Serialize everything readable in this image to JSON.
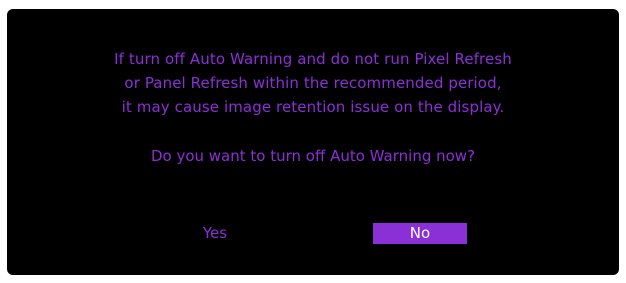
{
  "dialog": {
    "message_lines": [
      "If turn off Auto Warning and do not run Pixel Refresh",
      "or Panel Refresh within the recommended period,",
      "it may cause image retention issue on the display."
    ],
    "question": "Do you want to turn off Auto Warning now?",
    "buttons": {
      "yes_label": "Yes",
      "no_label": "No",
      "selected": "No"
    }
  },
  "colors": {
    "dialog_background": "#000000",
    "accent": "#8b2fd6",
    "selected_button_text": "#ffffff",
    "page_background": "#ffffff"
  }
}
